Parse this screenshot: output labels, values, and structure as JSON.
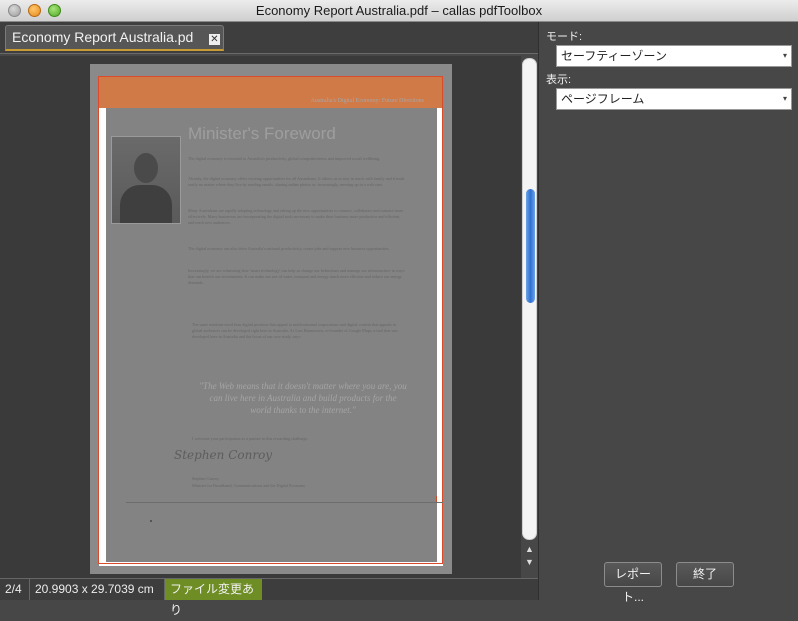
{
  "window": {
    "title": "Economy Report Australia.pdf – callas pdfToolbox"
  },
  "tab": {
    "label": "Economy Report Australia.pd",
    "close_icon": "close-icon"
  },
  "document": {
    "header_text": "Australia's Digital Economy: Future Directions",
    "heading": "Minister's Foreword",
    "paragraphs": [
      "The digital economy is essential to Australia's productivity, global competitiveness and improved social wellbeing.",
      "Already, the digital economy offers exciting opportunities for all Australians. It allows us to stay in touch with family and friends easily no matter where they live by sending emails, sharing online photos or, increasingly, meeting up in a web cam.",
      "Many Australians are rapidly adopting technology and taking up the new opportunities to connect, collaborate and transact more effectively. Many businesses are incorporating the digital tools necessary to make their business more productive and efficient, and reach new audiences.",
      "The digital economy can also drive Australia's national productivity, create jobs and support new business opportunities.",
      "Increasingly, we are witnessing how 'smart technology' can help us change our behaviours and manage our infrastructure in ways that can benefit our environment. It can make our use of water, transport and energy much more efficient and reduce our energy demands.",
      "The same medium-sized firm digital products that appeal to multi-national corporations and digital content that appeals to global audiences can be developed right here in Australia. As Lars Rasmussen, co-founder of Google Maps, a tool that was developed here in Australia and the focus of our case study, says:"
    ],
    "quote": "\"The Web means that it doesn't matter where you are, you can live here in Australia and build products for the world thanks to the internet.\"",
    "closing": "I welcome your participation as a partner in this rewarding challenge.",
    "signature": "Stephen Conroy",
    "signoff_name": "Stephen Conroy",
    "signoff_title": "Minister for Broadband, Communications and the Digital Economy"
  },
  "status": {
    "page": "2/4",
    "size": "20.9903 x 29.7039 cm",
    "modified": "ファイル変更あり"
  },
  "panel": {
    "mode_label": "モード:",
    "mode_value": "セーフティーゾーン",
    "display_label": "表示:",
    "display_value": "ページフレーム",
    "report_button": "レポート...",
    "quit_button": "終了"
  },
  "colors": {
    "frame_red": "#d94b2a",
    "tab_accent": "#c99b35",
    "status_green": "#6e8d25",
    "scroll_thumb": "#2f6fd0"
  }
}
